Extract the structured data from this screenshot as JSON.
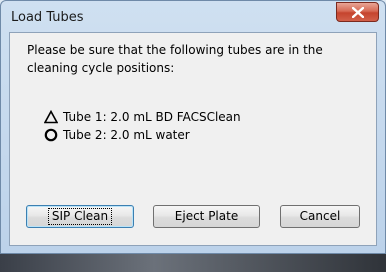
{
  "window": {
    "title": "Load Tubes",
    "close_icon": "close-x-icon"
  },
  "message": "Please be sure that the following tubes are in the cleaning cycle positions:",
  "tubes": [
    {
      "symbol": "triangle-outline-icon",
      "label": "Tube 1: 2.0 mL BD FACSClean"
    },
    {
      "symbol": "circle-outline-icon",
      "label": "Tube 2: 2.0 mL water"
    }
  ],
  "buttons": {
    "sip_clean": "SIP Clean",
    "eject_plate": "Eject Plate",
    "cancel": "Cancel"
  },
  "colors": {
    "close_button": "#c5442e",
    "default_button_border": "#3c7fb1"
  }
}
